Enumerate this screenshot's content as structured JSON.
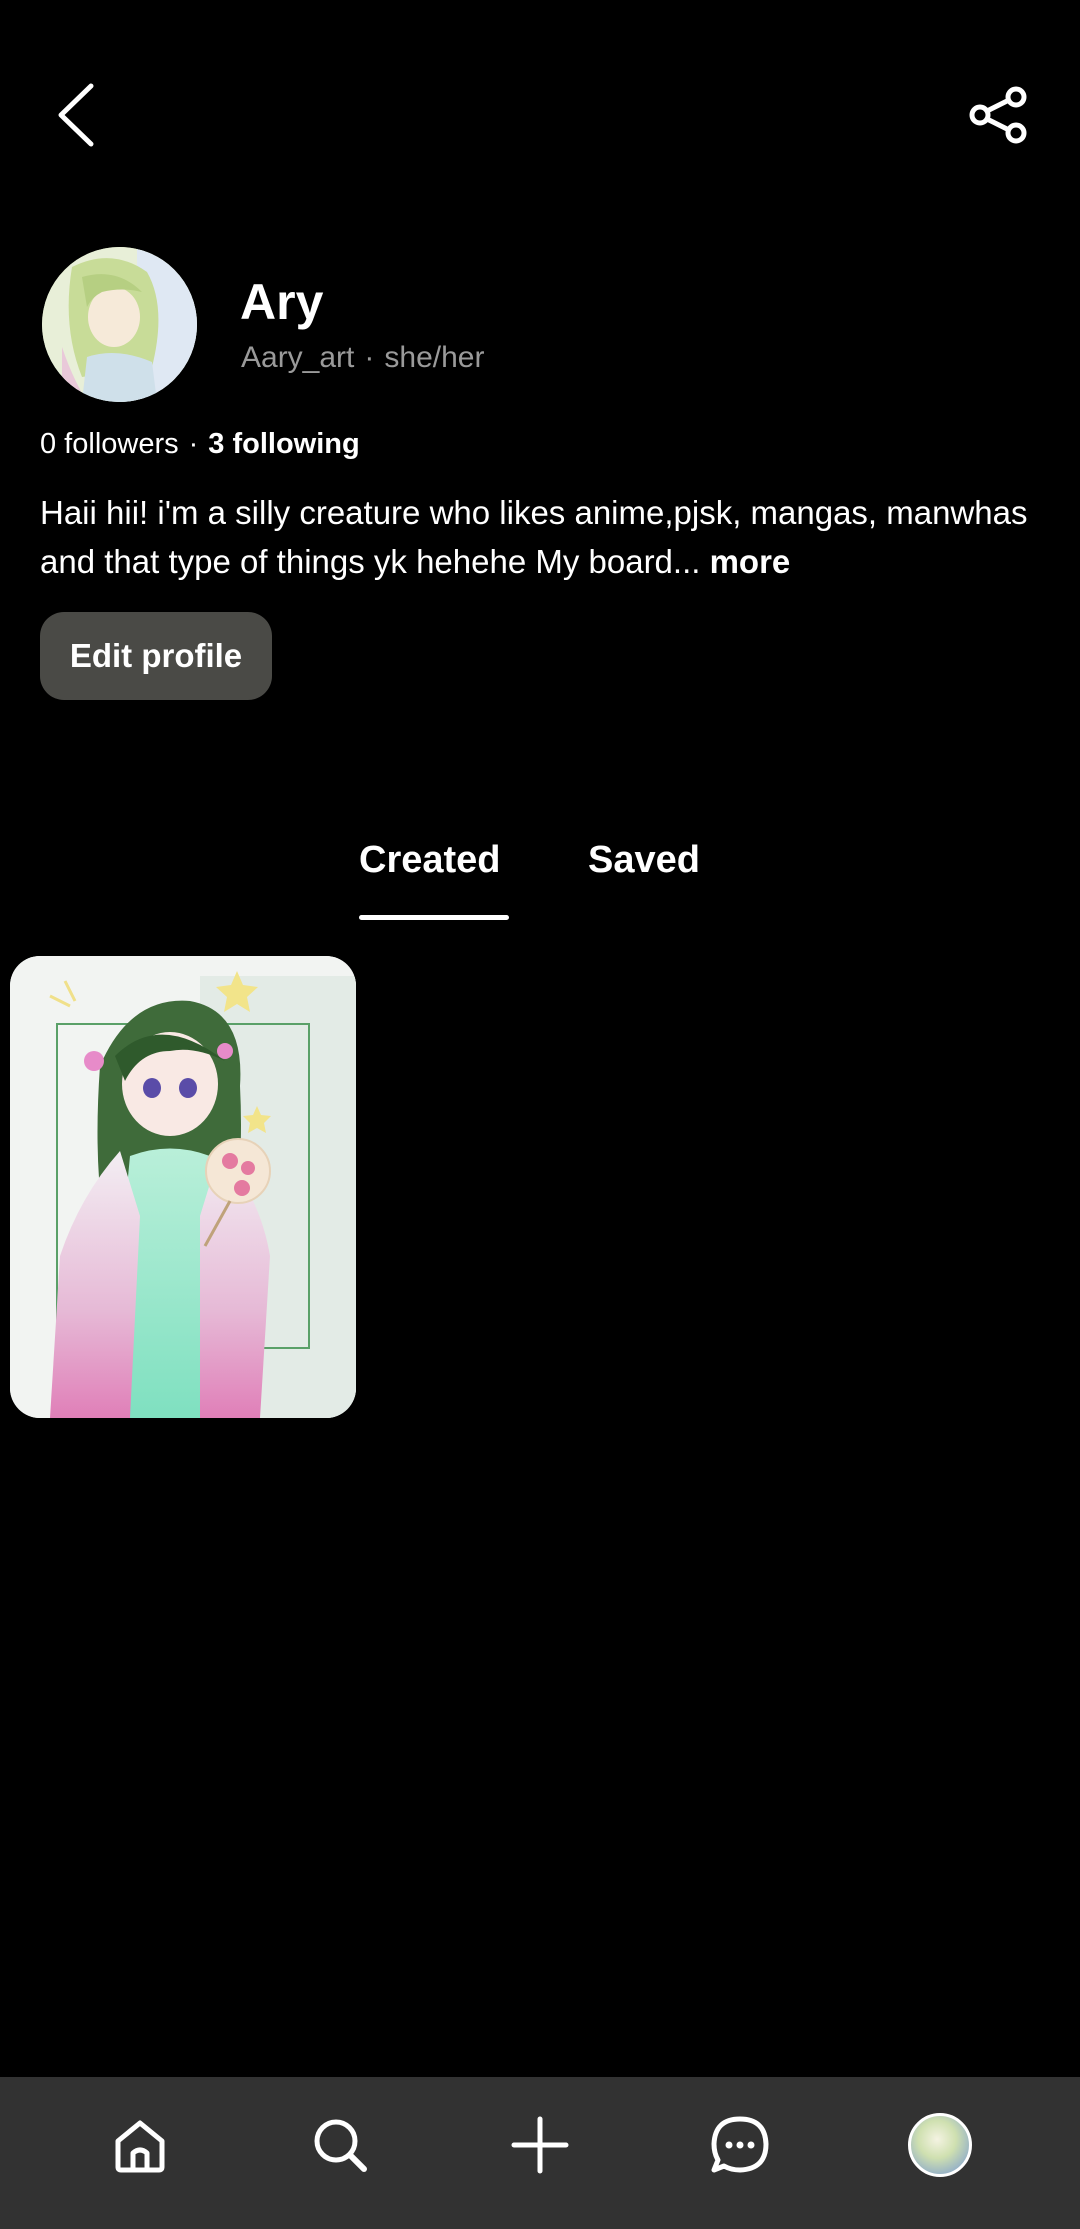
{
  "header": {
    "back_icon": "chevron-left-icon",
    "share_icon": "share-icon"
  },
  "profile": {
    "name": "Ary",
    "username": "Aary_art",
    "separator": "·",
    "pronouns": "she/her",
    "followers": "0 followers",
    "following": "3 following",
    "bio": "Haii hii!  i'm a silly creature who likes anime,pjsk, mangas, manwhas and that type of things yk hehehe  My board...",
    "bio_more": "more",
    "edit_button": "Edit profile"
  },
  "tabs": {
    "created": "Created",
    "saved": "Saved",
    "active": "created"
  },
  "pins": [
    {
      "type": "illustration"
    }
  ],
  "bottom_nav": {
    "items": [
      "home-icon",
      "search-icon",
      "plus-icon",
      "messages-icon",
      "profile-avatar"
    ]
  }
}
